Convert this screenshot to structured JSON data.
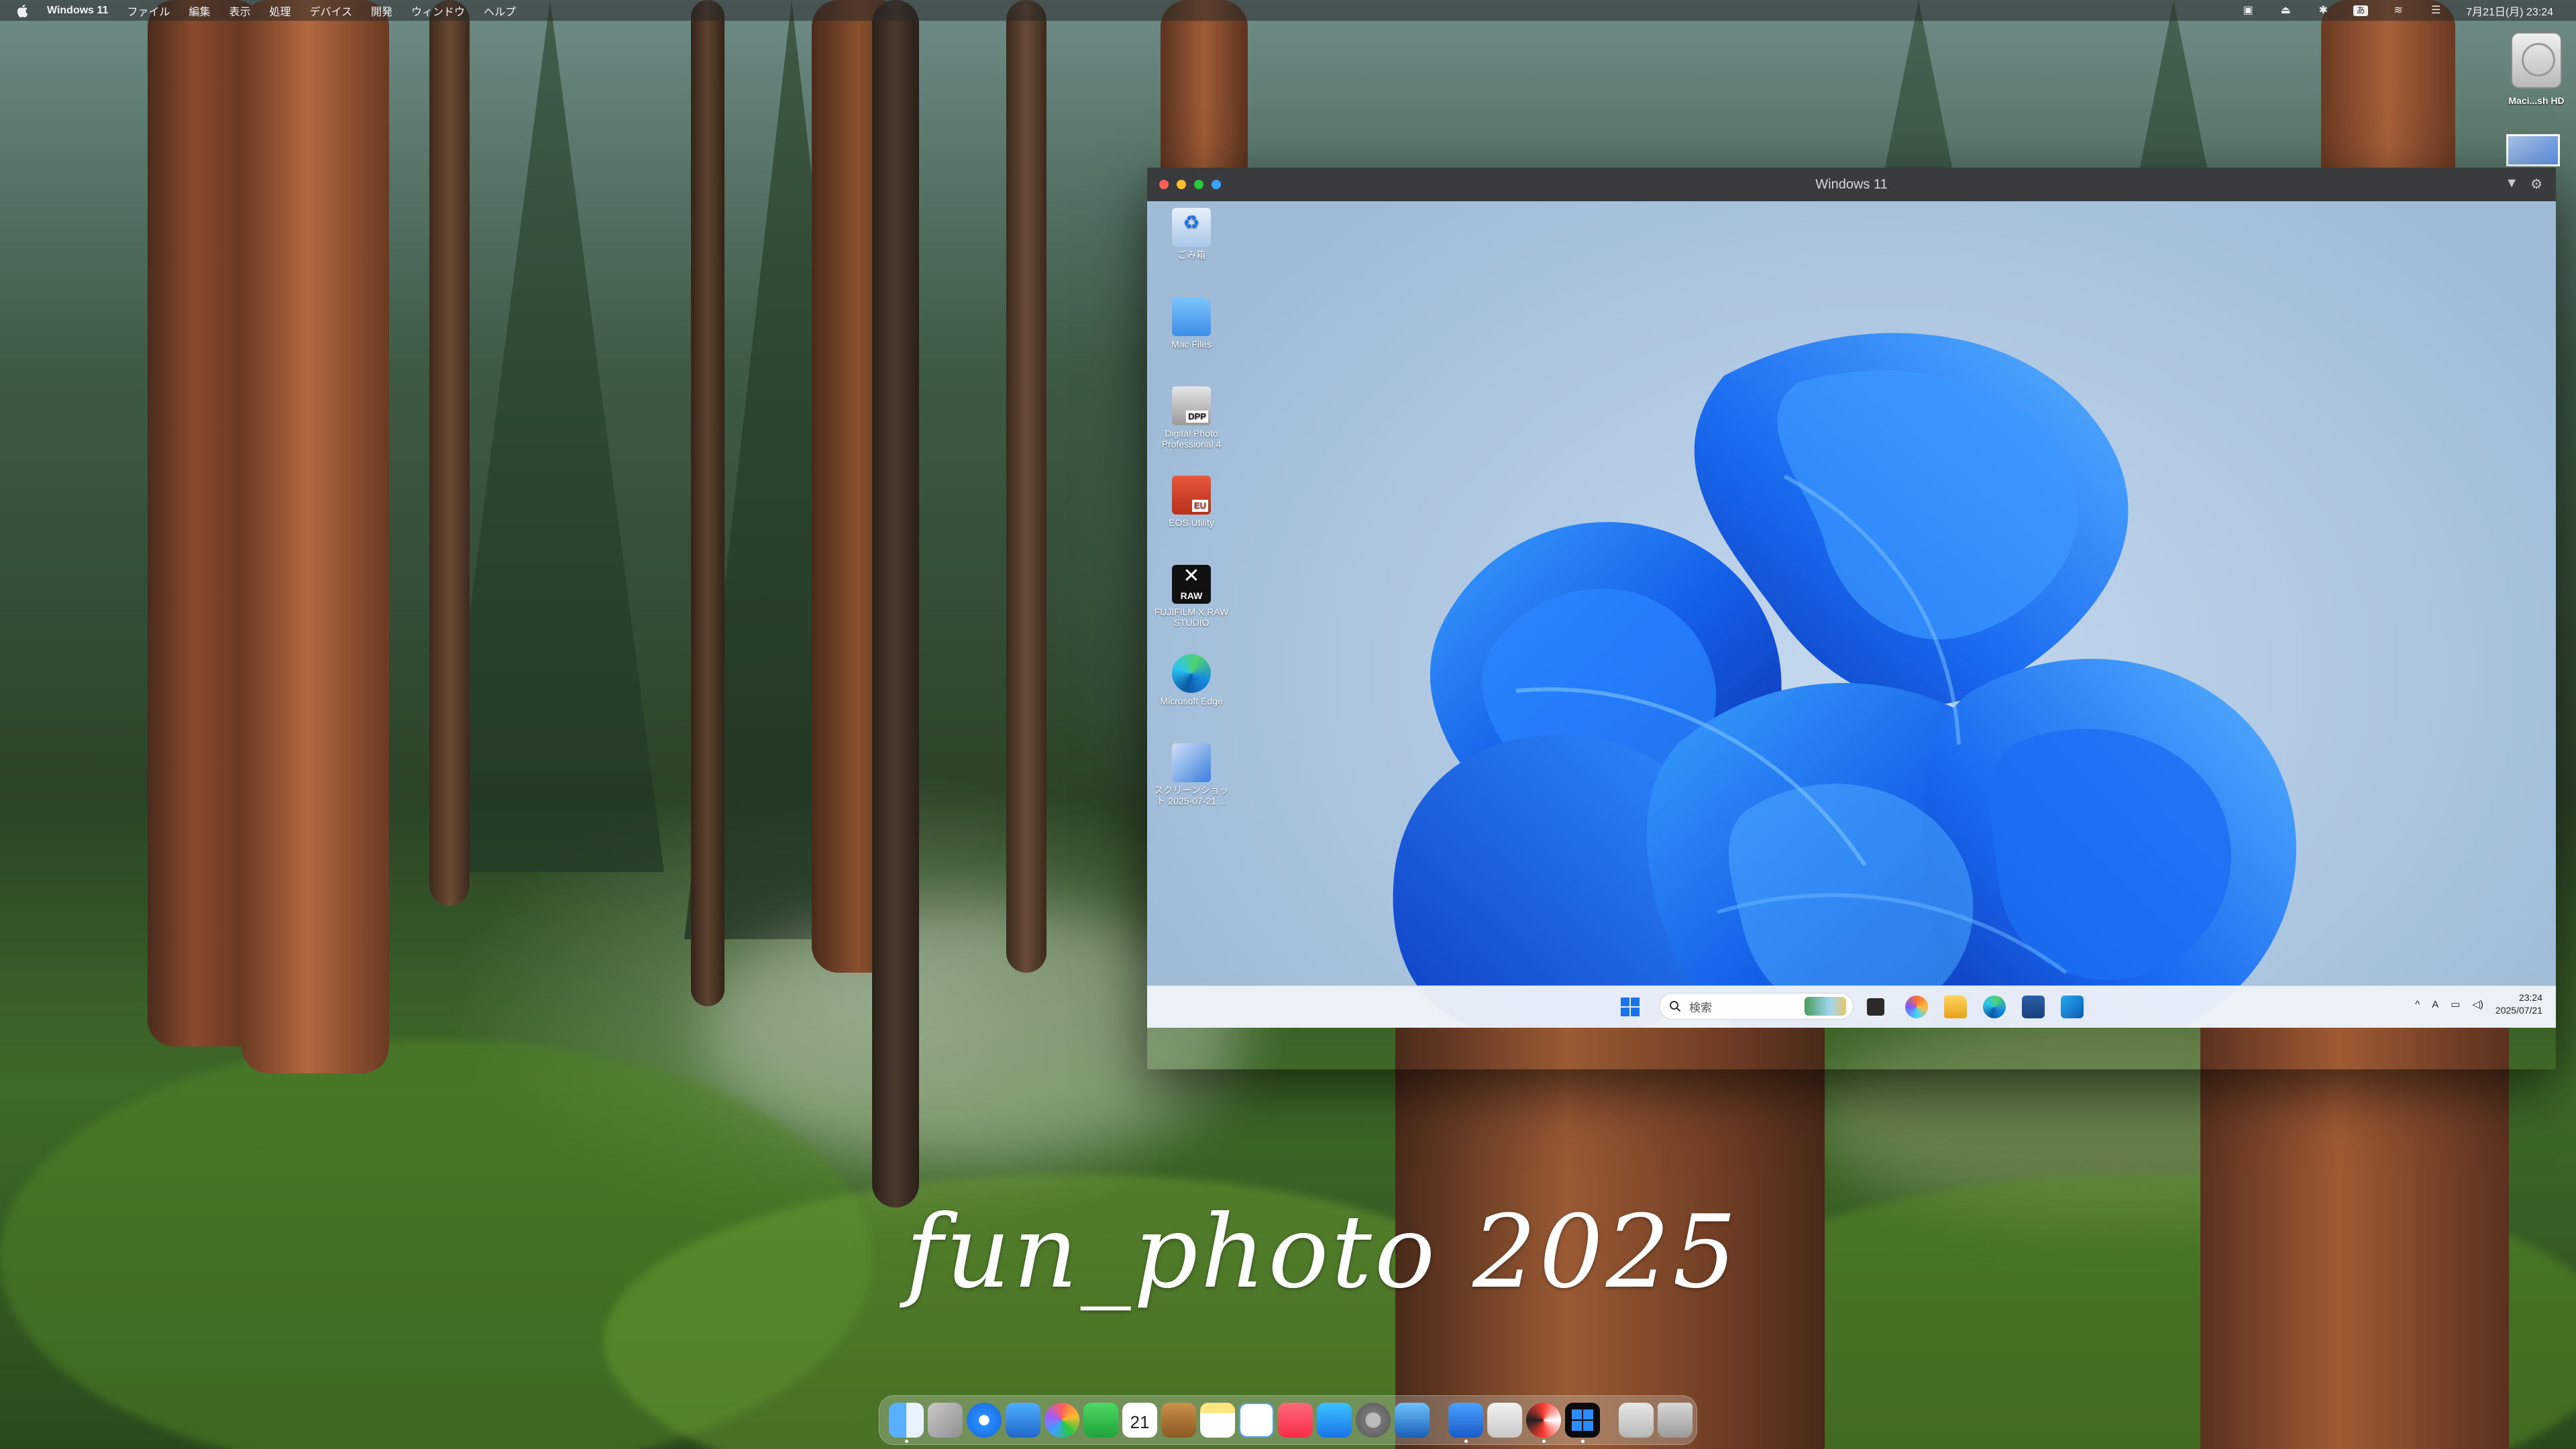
{
  "menubar": {
    "app_name": "Windows 11",
    "menus": [
      "ファイル",
      "編集",
      "表示",
      "処理",
      "デバイス",
      "開発",
      "ウィンドウ",
      "ヘルプ"
    ],
    "input_mode": "あ",
    "datetime": "7月21日(月) 23:24"
  },
  "desktop": {
    "hd_label": "Maci...sh HD"
  },
  "vm_window": {
    "title": "Windows 11",
    "icons": [
      {
        "label": "ごみ箱",
        "icon": "recycle-bin-icon"
      },
      {
        "label": "Mac Files",
        "icon": "mac-files-folder-icon"
      },
      {
        "label": "Digital Photo Professional 4",
        "icon": "dpp-icon",
        "badge": "DPP"
      },
      {
        "label": "EOS Utility",
        "icon": "eos-utility-icon",
        "badge": "EU"
      },
      {
        "label": "FUJIFILM X RAW STUDIO",
        "icon": "fujifilm-raw-icon",
        "badge": "RAW"
      },
      {
        "label": "Microsoft Edge",
        "icon": "edge-icon"
      },
      {
        "label": "スクリーンショット 2025-07-21 ...",
        "icon": "screenshot-file-icon"
      }
    ],
    "taskbar": {
      "search_placeholder": "検索",
      "ime": "A",
      "time": "23:24",
      "date": "2025/07/21"
    }
  },
  "watermark": "fun_photo 2025",
  "dock": {
    "calendar_day": "21",
    "items": [
      "finder-icon",
      "launchpad-icon",
      "safari-icon",
      "preview-icon",
      "photos-icon",
      "facetime-icon",
      "calendar-icon",
      "notes-app-icon",
      "notes-icon",
      "freeform-icon",
      "music-icon",
      "app-store-icon",
      "system-settings-icon",
      "xcode-icon",
      "remote-desktop-icon",
      "preview-doc-icon",
      "color-icon",
      "windows-icon",
      "downloads-icon",
      "trash-icon"
    ]
  },
  "colors": {
    "win_accent": "#1a73e8",
    "traffic_close": "#ff5f57",
    "traffic_min": "#febc2e",
    "traffic_max": "#28c840",
    "traffic_full": "#3aa3ff"
  }
}
